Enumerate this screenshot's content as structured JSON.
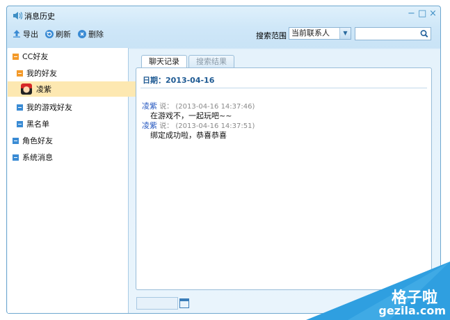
{
  "window": {
    "title": "消息历史",
    "controls": {
      "minimize": "−",
      "maximize": "□",
      "close": "×"
    }
  },
  "toolbar": {
    "export_label": "导出",
    "refresh_label": "刷新",
    "delete_label": "删除",
    "search_range_label": "搜索范围",
    "search_range_value": "当前联系人",
    "search_value": ""
  },
  "tree": {
    "root": "CC好友",
    "my_friends": "我的好友",
    "friend_selected": "凌紫",
    "game_friends": "我的游戏好友",
    "blacklist": "黑名单",
    "role_friends": "角色好友",
    "system_messages": "系统消息"
  },
  "tabs": [
    {
      "label": "聊天记录",
      "active": true
    },
    {
      "label": "搜索结果",
      "active": false
    }
  ],
  "chat": {
    "date_label": "日期：2013-04-16",
    "messages": [
      {
        "sender": "凌紫",
        "said": "说：",
        "time": "(2013-04-16 14:37:46)",
        "text": "在游戏不，一起玩吧~~"
      },
      {
        "sender": "凌紫",
        "said": "说：",
        "time": "(2013-04-16 14:37:51)",
        "text": "绑定成功啦，恭喜恭喜"
      }
    ]
  },
  "watermark": {
    "cn": "格子啦",
    "en": "gezila.com"
  },
  "colors": {
    "accent": "#3a8bd4",
    "tree_open": "#f39a2a",
    "selected_row": "#fde8b1",
    "date_text": "#1e5a93",
    "watermark_blue": "#2f9fe0"
  }
}
